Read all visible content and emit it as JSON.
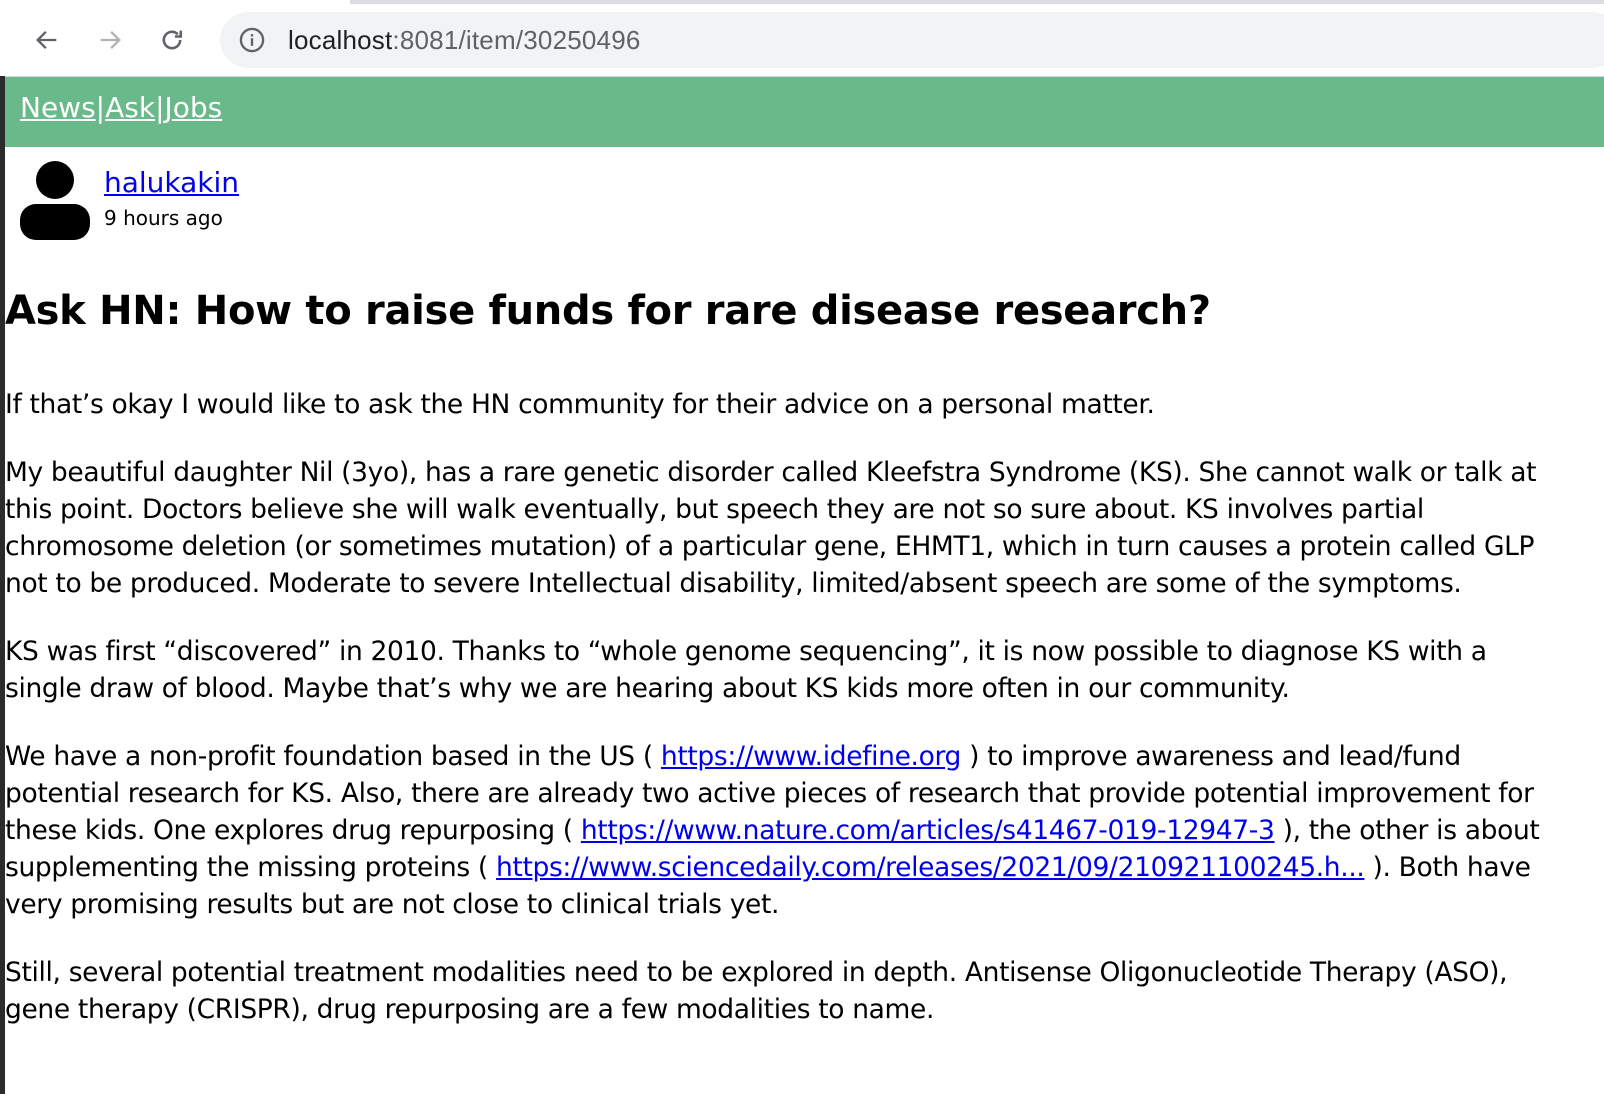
{
  "browser": {
    "url_host": "localhost",
    "url_path": ":8081/item/30250496"
  },
  "nav": {
    "items": [
      "News",
      "Ask",
      "Jobs"
    ],
    "separator": "|"
  },
  "author": {
    "name": "halukakin",
    "time": "9 hours ago"
  },
  "post": {
    "title": "Ask HN: How to raise funds for rare disease research?",
    "p1": "If that’s okay I would like to ask the HN community for their advice on a personal matter.",
    "p2": "My beautiful daughter Nil (3yo), has a rare genetic disorder called Kleefstra Syndrome (KS). She cannot walk or talk at this point. Doctors believe she will walk eventually, but speech they are not so sure about. KS involves partial chromosome deletion (or sometimes mutation) of a particular gene, EHMT1, which in turn causes a protein called GLP not to be produced. Moderate to severe Intellectual disability, limited/absent speech are some of the symptoms.",
    "p3": "KS was first “discovered” in 2010. Thanks to “whole genome sequencing”, it is now possible to diagnose KS with a single draw of blood. Maybe that’s why we are hearing about KS kids more often in our community.",
    "p4": {
      "t1": "We have a non-profit foundation based in the US ( ",
      "link1": "https://www.idefine.org",
      "t2": " ) to improve awareness and lead/fund potential research for KS. Also, there are already two active pieces of research that provide potential improvement for these kids. One explores drug repurposing ( ",
      "link2": "https://www.nature.com/articles/s41467-019-12947-3",
      "t3": " ), the other is about supplementing the missing proteins ( ",
      "link3": "https://www.sciencedaily.com/releases/2021/09/210921100245.h...",
      "t4": " ). Both have very promising results but are not close to clinical trials yet."
    },
    "p5": "Still, several potential treatment modalities need to be explored in depth. Antisense Oligonucleotide Therapy (ASO), gene therapy (CRISPR), drug repurposing are a few modalities to name."
  }
}
